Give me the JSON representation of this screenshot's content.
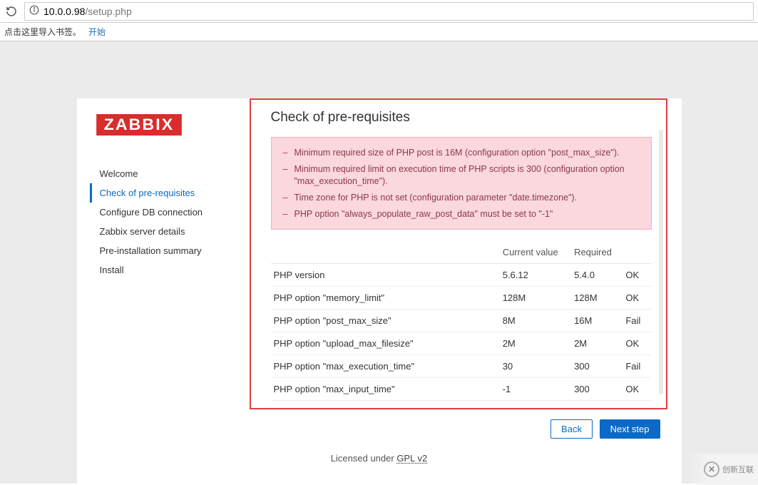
{
  "browser": {
    "url_ip": "10.0.0.98",
    "url_path": "/setup.php"
  },
  "bookmarks": {
    "hint": "点击这里导入书签。",
    "start": "开始"
  },
  "logo_text": "ZABBIX",
  "nav": {
    "items": [
      "Welcome",
      "Check of pre-requisites",
      "Configure DB connection",
      "Zabbix server details",
      "Pre-installation summary",
      "Install"
    ],
    "active_index": 1
  },
  "title": "Check of pre-requisites",
  "warnings": [
    "Minimum required size of PHP post is 16M (configuration option \"post_max_size\").",
    "Minimum required limit on execution time of PHP scripts is 300 (configuration option \"max_execution_time\").",
    "Time zone for PHP is not set (configuration parameter \"date.timezone\").",
    "PHP option \"always_populate_raw_post_data\" must be set to \"-1\""
  ],
  "table": {
    "headers": {
      "name": "",
      "current": "Current value",
      "required": "Required",
      "status": ""
    },
    "rows": [
      {
        "name": "PHP version",
        "current": "5.6.12",
        "required": "5.4.0",
        "status": "OK"
      },
      {
        "name": "PHP option \"memory_limit\"",
        "current": "128M",
        "required": "128M",
        "status": "OK"
      },
      {
        "name": "PHP option \"post_max_size\"",
        "current": "8M",
        "required": "16M",
        "status": "Fail"
      },
      {
        "name": "PHP option \"upload_max_filesize\"",
        "current": "2M",
        "required": "2M",
        "status": "OK"
      },
      {
        "name": "PHP option \"max_execution_time\"",
        "current": "30",
        "required": "300",
        "status": "Fail"
      },
      {
        "name": "PHP option \"max_input_time\"",
        "current": "-1",
        "required": "300",
        "status": "OK"
      }
    ]
  },
  "buttons": {
    "back": "Back",
    "next": "Next step"
  },
  "license": {
    "text": "Licensed under ",
    "link": "GPL v2"
  },
  "watermark": {
    "brand": "创新互联"
  }
}
